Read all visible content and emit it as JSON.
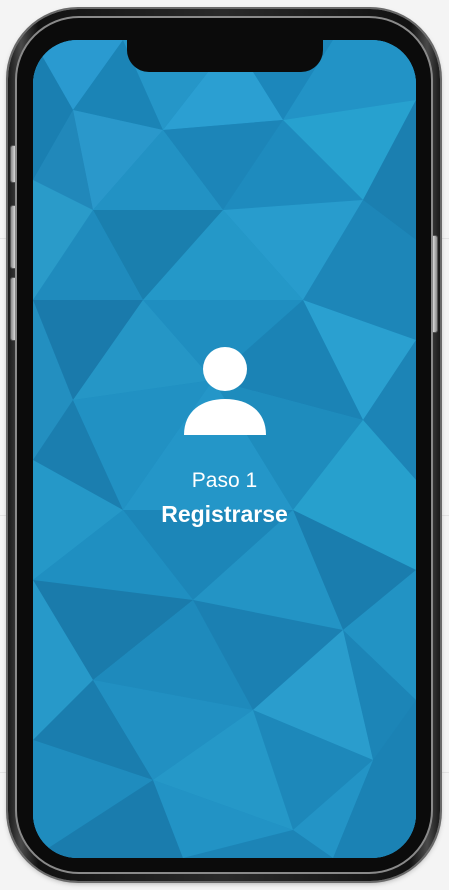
{
  "screen": {
    "icon": "user-icon",
    "step_label": "Paso 1",
    "title": "Registrarse"
  },
  "colors": {
    "background": "#1f8ec0",
    "text": "#ffffff",
    "frame": "#1a1a1a"
  }
}
